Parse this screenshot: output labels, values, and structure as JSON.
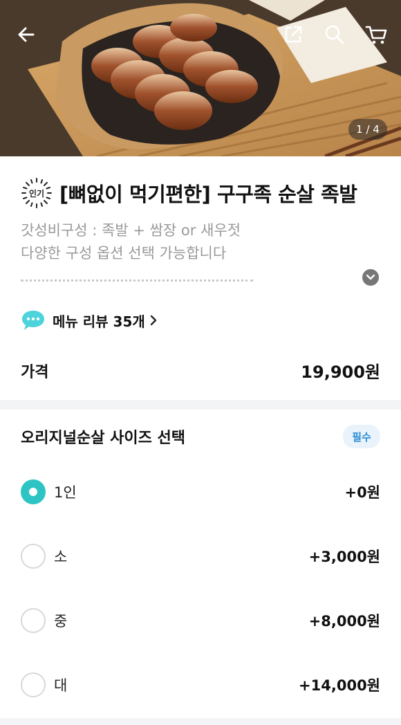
{
  "hero": {
    "counter": "1 / 4",
    "icons": [
      "back-arrow-icon",
      "share-icon",
      "search-icon",
      "cart-icon"
    ]
  },
  "product": {
    "badge": "인기",
    "title": "[뼈없이 먹기편한] 구구족 순살 족발",
    "desc_line1": "갓성비구성 : 족발 + 쌈장 or 새우젓",
    "desc_line2": "다양한 구성 옵션 선택 가능합니다"
  },
  "review": {
    "label": "메뉴 리뷰 35개"
  },
  "price": {
    "label": "가격",
    "value": "19,900원"
  },
  "options": {
    "title": "오리지널순살 사이즈 선택",
    "required": "필수",
    "items": [
      {
        "name": "1인",
        "add": "+0원",
        "selected": true
      },
      {
        "name": "소",
        "add": "+3,000원",
        "selected": false
      },
      {
        "name": "중",
        "add": "+8,000원",
        "selected": false
      },
      {
        "name": "대",
        "add": "+14,000원",
        "selected": false
      }
    ]
  },
  "colors": {
    "accent": "#2ec4c4",
    "required_text": "#2a8fd6"
  }
}
